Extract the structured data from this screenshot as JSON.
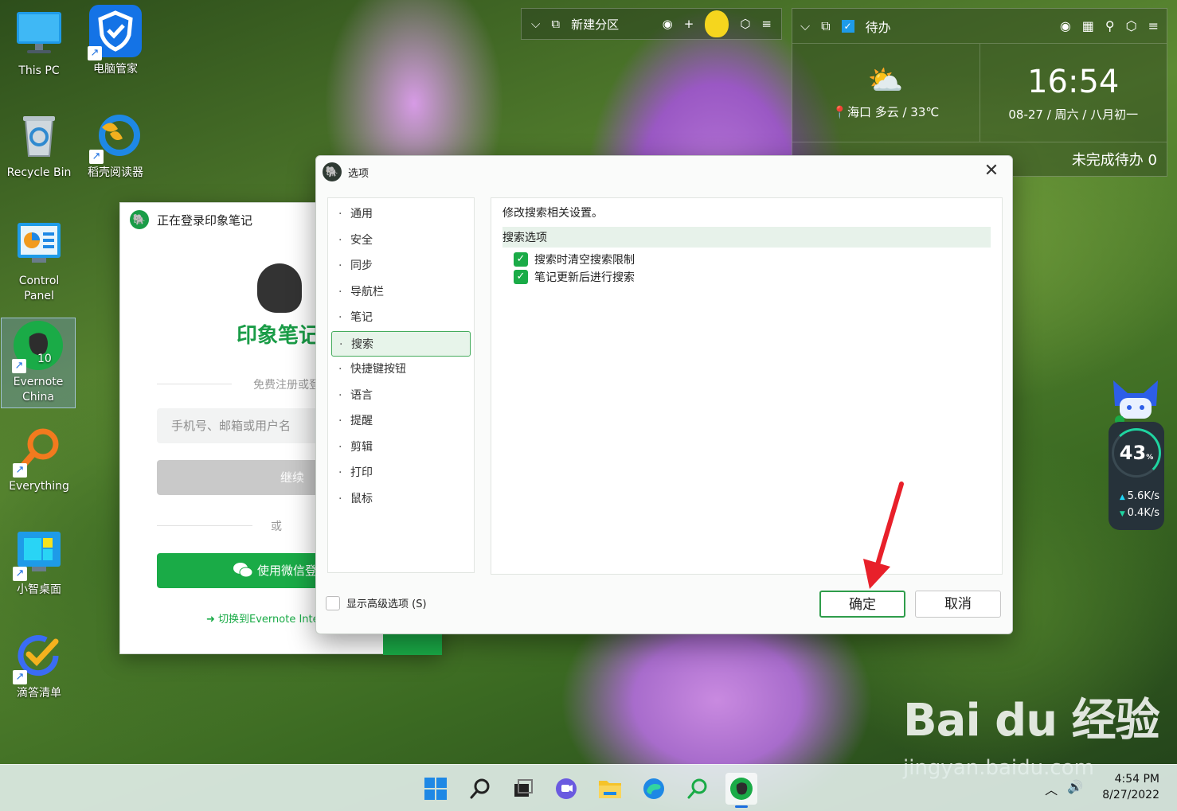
{
  "desktop": {
    "icons": [
      {
        "label": "This PC"
      },
      {
        "label": "电脑管家"
      },
      {
        "label": "Recycle Bin"
      },
      {
        "label": "稻壳阅读器"
      },
      {
        "label": "Control Panel"
      },
      {
        "label": "Evernote China"
      },
      {
        "label": "Everything"
      },
      {
        "label": "小智桌面"
      },
      {
        "label": "滴答清单"
      }
    ]
  },
  "top_widget": {
    "partition_label": "新建分区"
  },
  "clock_widget": {
    "todo_tab": "待办",
    "time": "16:54",
    "date": "08-27 / 周六 / 八月初一",
    "weather": "海口  多云 / 33℃",
    "todo_count": "未完成待办 0"
  },
  "login_window": {
    "title": "正在登录印象笔记",
    "brand": "印象笔记",
    "register_text": "免费注册或登录",
    "username_placeholder": "手机号、邮箱或用户名",
    "continue_label": "继续",
    "or_text": "或",
    "wechat_label": "使用微信登录",
    "switch_link": "➜ 切换到Evernote International"
  },
  "options_dialog": {
    "title": "选项",
    "nav_items": [
      "通用",
      "安全",
      "同步",
      "导航栏",
      "笔记",
      "搜索",
      "快捷键按钮",
      "语言",
      "提醒",
      "剪辑",
      "打印",
      "鼠标"
    ],
    "selected_nav": "搜索",
    "panel": {
      "description": "修改搜索相关设置。",
      "section_title": "搜索选项",
      "options": [
        {
          "label": "搜索时清空搜索限制",
          "checked": true
        },
        {
          "label": "笔记更新后进行搜索",
          "checked": true
        }
      ]
    },
    "advanced_label": "显示高级选项 (S)",
    "ok_label": "确定",
    "cancel_label": "取消"
  },
  "monitor_widget": {
    "cpu_percent": "43",
    "percent_sign": "%",
    "upload": "5.6K/s",
    "download": "0.4K/s"
  },
  "watermark": {
    "brand": "Bai du 经验",
    "url": "jingyan.baidu.com"
  },
  "taskbar": {
    "time": "4:54 PM",
    "date": "8/27/2022"
  }
}
